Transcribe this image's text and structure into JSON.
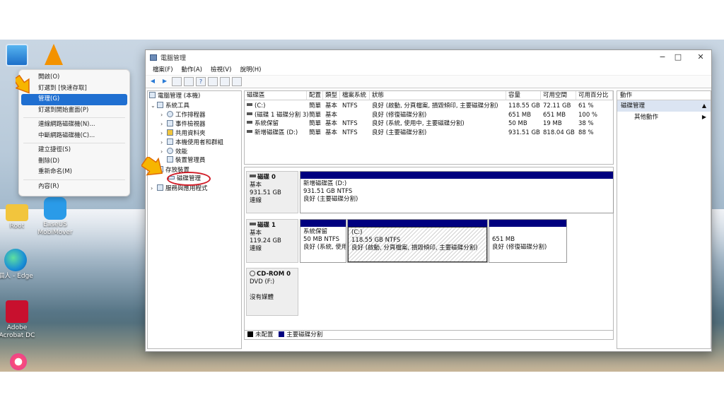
{
  "desktop": {
    "icons": [
      {
        "label": "Root"
      },
      {
        "label": "EaseUS MobiMover"
      },
      {
        "label": "個人 - Edge"
      },
      {
        "label": "Adobe Acrobat DC"
      }
    ]
  },
  "context_menu": {
    "items": [
      {
        "label": "開啟(O)"
      },
      {
        "label": "釘選到 [快速存取]"
      },
      {
        "label": "管理(G)"
      },
      {
        "label": "釘選到開始畫面(P)"
      },
      {
        "label": "連線網路磁碟機(N)..."
      },
      {
        "label": "中斷網路磁碟機(C)..."
      },
      {
        "label": "建立捷徑(S)"
      },
      {
        "label": "刪除(D)"
      },
      {
        "label": "重新命名(M)"
      },
      {
        "label": "內容(R)"
      }
    ]
  },
  "window": {
    "title": "電腦管理",
    "controls": {
      "minimize": "−",
      "maximize": "□",
      "close": "✕"
    },
    "menu": [
      "檔案(F)",
      "動作(A)",
      "檢視(V)",
      "說明(H)"
    ]
  },
  "tree": {
    "root": "電腦管理 (本機)",
    "system_tools": "系統工具",
    "task_scheduler": "工作排程器",
    "event_viewer": "事件檢視器",
    "shared_folders": "共用資料夾",
    "local_users": "本機使用者和群組",
    "performance": "效能",
    "device_manager": "裝置管理員",
    "storage": "存放裝置",
    "disk_management": "磁碟管理",
    "services": "服務與應用程式"
  },
  "volumes": {
    "headers": [
      "磁碟區",
      "配置",
      "類型",
      "檔案系統",
      "狀態",
      "容量",
      "可用空間",
      "可用百分比"
    ],
    "rows": [
      [
        "(C:)",
        "簡單",
        "基本",
        "NTFS",
        "良好 (啟動, 分頁檔案, 損毀傾印, 主要磁碟分割)",
        "118.55 GB",
        "72.11 GB",
        "61 %"
      ],
      [
        "(磁碟 1 磁碟分割 3)",
        "簡單",
        "基本",
        "",
        "良好 (修復磁碟分割)",
        "651 MB",
        "651 MB",
        "100 %"
      ],
      [
        "系統保留",
        "簡單",
        "基本",
        "NTFS",
        "良好 (系統, 使用中, 主要磁碟分割)",
        "50 MB",
        "19 MB",
        "38 %"
      ],
      [
        "新增磁碟區 (D:)",
        "簡單",
        "基本",
        "NTFS",
        "良好 (主要磁碟分割)",
        "931.51 GB",
        "818.04 GB",
        "88 %"
      ]
    ]
  },
  "disks": {
    "disk0": {
      "name": "磁碟 0",
      "type": "基本",
      "size": "931.51 GB",
      "status": "連線",
      "parts": [
        {
          "name": "新增磁碟區 (D:)",
          "size": "931.51 GB NTFS",
          "status": "良好 (主要磁碟分割)"
        }
      ]
    },
    "disk1": {
      "name": "磁碟 1",
      "type": "基本",
      "size": "119.24 GB",
      "status": "連線",
      "parts": [
        {
          "name": "系統保留",
          "size": "50 MB NTFS",
          "status": "良好 (系統, 使用中"
        },
        {
          "name": "(C:)",
          "size": "118.55 GB NTFS",
          "status": "良好 (啟動, 分頁檔案, 損毀傾印, 主要磁碟分割)"
        },
        {
          "name": "",
          "size": "651 MB",
          "status": "良好 (修復磁碟分割)"
        }
      ]
    },
    "cdrom": {
      "name": "CD-ROM 0",
      "type": "DVD (F:)",
      "status": "沒有媒體"
    }
  },
  "legend": {
    "unallocated": "未配置",
    "primary": "主要磁碟分割"
  },
  "colors": {
    "unallocated": "#000000",
    "primary": "#00007f",
    "selection": "#1f6fd1",
    "annotation": "#d21f2a"
  },
  "actions": {
    "header": "動作",
    "selected": "磁碟管理",
    "more": "其他動作"
  }
}
